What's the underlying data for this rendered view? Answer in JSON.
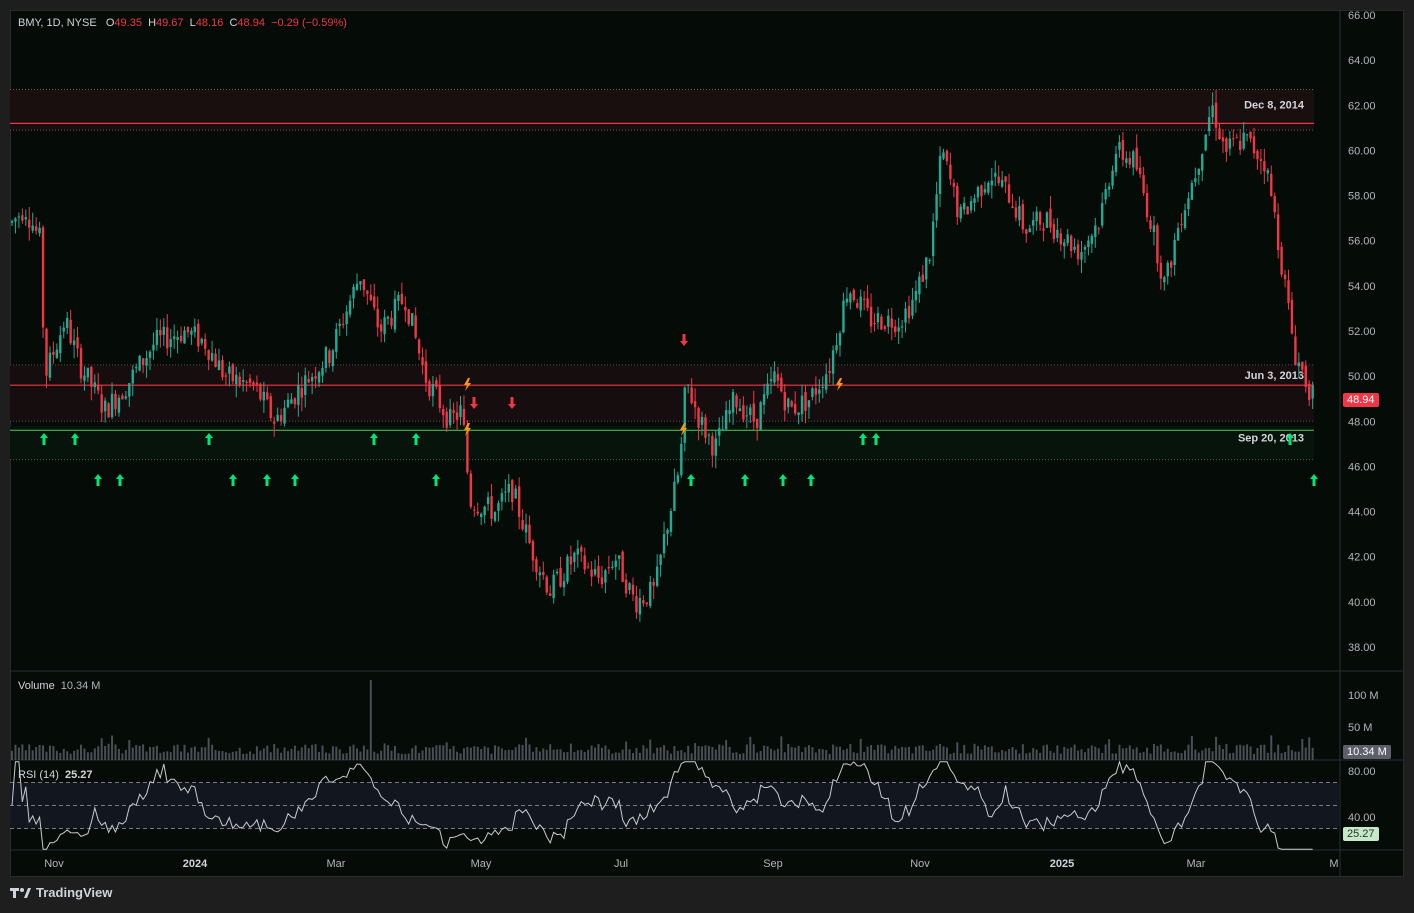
{
  "legend": {
    "symbol": "BMY, 1D, NYSE",
    "o_label": "O",
    "o": "49.35",
    "h_label": "H",
    "h": "49.67",
    "l_label": "L",
    "l": "48.16",
    "c_label": "C",
    "c": "48.94",
    "change": "−0.29 (−0.59%)"
  },
  "last_price": "48.94",
  "volume": {
    "title": "Volume",
    "value": "10.34 M",
    "ticks": [
      "100 M",
      "50 M"
    ],
    "tag": "10.34 M"
  },
  "rsi": {
    "title": "RSI (14)",
    "value": "25.27",
    "ticks": [
      "80.00",
      "40.00"
    ],
    "tag": "25.27"
  },
  "levels": [
    {
      "label": "Dec 8, 2014",
      "price": 61.2
    },
    {
      "label": "Jun 3, 2013",
      "price": 49.6
    },
    {
      "label": "Sep 20, 2013",
      "price": 47.6
    }
  ],
  "x_labels": [
    "Nov",
    "2024",
    "Mar",
    "May",
    "Jul",
    "Sep",
    "Nov",
    "2025",
    "Mar",
    "M"
  ],
  "y_ticks": [
    "66.00",
    "64.00",
    "62.00",
    "60.00",
    "58.00",
    "56.00",
    "54.00",
    "52.00",
    "50.00",
    "48.00",
    "46.00",
    "44.00",
    "42.00",
    "40.00",
    "38.00"
  ],
  "brand": "TradingView",
  "colors": {
    "up": "#089981",
    "down": "#f23645",
    "signal_up": "#00e676",
    "signal_down": "#f23645",
    "bolt": "#ff9800",
    "bg": "#050b07"
  },
  "chart_data": {
    "type": "line",
    "title": "BMY, 1D, NYSE",
    "xlabel": "",
    "ylabel": "",
    "ylim": [
      37,
      66.5
    ],
    "x": [
      "Oct 2023",
      "Nov 2023",
      "Dec 2023",
      "Jan 2024",
      "Feb 2024",
      "Mar 2024",
      "Apr 2024",
      "May 2024",
      "Jun 2024",
      "Jul 2024",
      "Aug 2024",
      "Sep 2024",
      "Oct 2024",
      "Nov 2024",
      "Dec 2024",
      "Jan 2025",
      "Feb 2025",
      "Mar 2025",
      "Apr 2025"
    ],
    "series": [
      {
        "name": "Close",
        "values": [
          57.0,
          50.0,
          49.0,
          51.5,
          49.0,
          52.0,
          53.0,
          44.5,
          41.0,
          40.5,
          48.5,
          50.5,
          54.0,
          58.5,
          57.5,
          59.0,
          56.5,
          60.5,
          48.94
        ]
      }
    ]
  }
}
